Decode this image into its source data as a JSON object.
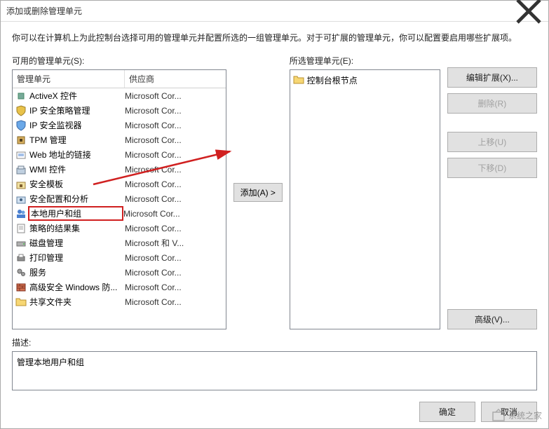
{
  "title": "添加或删除管理单元",
  "intro": "你可以在计算机上为此控制台选择可用的管理单元并配置所选的一组管理单元。对于可扩展的管理单元，你可以配置要启用哪些扩展项。",
  "available_label": "可用的管理单元(S):",
  "selected_label": "所选管理单元(E):",
  "columns": {
    "snapin": "管理单元",
    "vendor": "供应商"
  },
  "snapins": [
    {
      "name": "ActiveX 控件",
      "vendor": "Microsoft Cor...",
      "icon": "gear"
    },
    {
      "name": "IP 安全策略管理",
      "vendor": "Microsoft Cor...",
      "icon": "shield-y"
    },
    {
      "name": "IP 安全监视器",
      "vendor": "Microsoft Cor...",
      "icon": "shield-b"
    },
    {
      "name": "TPM 管理",
      "vendor": "Microsoft Cor...",
      "icon": "chip"
    },
    {
      "name": "Web 地址的链接",
      "vendor": "Microsoft Cor...",
      "icon": "link"
    },
    {
      "name": "WMI 控件",
      "vendor": "Microsoft Cor...",
      "icon": "db"
    },
    {
      "name": "安全模板",
      "vendor": "Microsoft Cor...",
      "icon": "lock"
    },
    {
      "name": "安全配置和分析",
      "vendor": "Microsoft Cor...",
      "icon": "lock2"
    },
    {
      "name": "本地用户和组",
      "vendor": "Microsoft Cor...",
      "icon": "users",
      "highlighted": true
    },
    {
      "name": "策略的结果集",
      "vendor": "Microsoft Cor...",
      "icon": "doc"
    },
    {
      "name": "磁盘管理",
      "vendor": "Microsoft 和 V...",
      "icon": "disk"
    },
    {
      "name": "打印管理",
      "vendor": "Microsoft Cor...",
      "icon": "printer"
    },
    {
      "name": "服务",
      "vendor": "Microsoft Cor...",
      "icon": "gears"
    },
    {
      "name": "高级安全 Windows 防...",
      "vendor": "Microsoft Cor...",
      "icon": "wall"
    },
    {
      "name": "共享文件夹",
      "vendor": "Microsoft Cor...",
      "icon": "folder"
    }
  ],
  "selected_root": "控制台根节点",
  "add_btn": "添加(A) >",
  "buttons": {
    "edit_ext": "编辑扩展(X)...",
    "remove": "删除(R)",
    "move_up": "上移(U)",
    "move_down": "下移(D)",
    "advanced": "高级(V)..."
  },
  "desc_label": "描述:",
  "desc_text": "管理本地用户和组",
  "footer": {
    "ok": "确定",
    "cancel": "取消"
  },
  "watermark": "系统之家"
}
